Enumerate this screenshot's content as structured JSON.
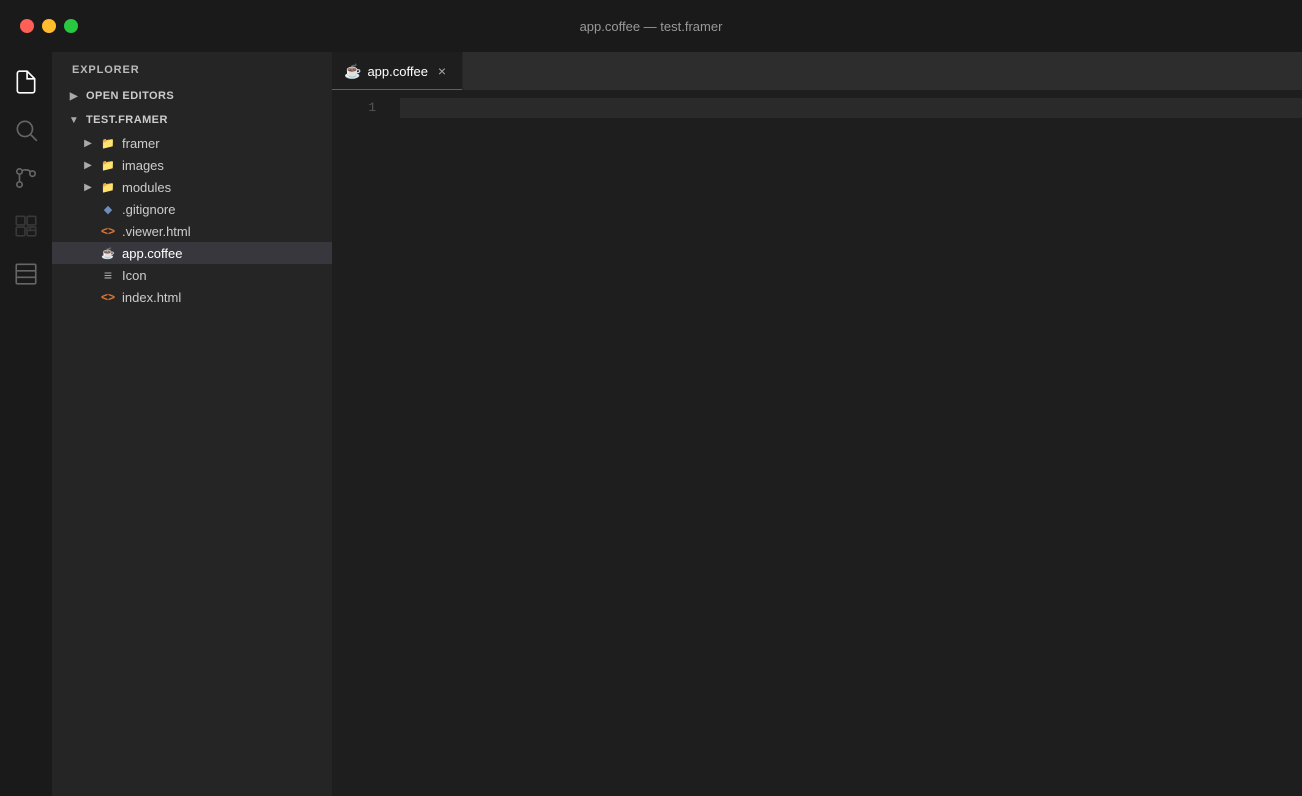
{
  "titlebar": {
    "title": "app.coffee — test.framer",
    "controls": {
      "close_label": "",
      "min_label": "",
      "max_label": ""
    }
  },
  "activity_bar": {
    "icons": [
      {
        "name": "explorer-icon",
        "label": "Explorer",
        "active": true
      },
      {
        "name": "search-icon",
        "label": "Search",
        "active": false
      },
      {
        "name": "source-control-icon",
        "label": "Source Control",
        "active": false
      },
      {
        "name": "extensions-icon",
        "label": "Extensions",
        "active": false
      },
      {
        "name": "layout-icon",
        "label": "Layout",
        "active": false
      }
    ]
  },
  "sidebar": {
    "header": "EXPLORER",
    "sections": [
      {
        "name": "open-editors",
        "label": "OPEN EDITORS",
        "collapsed": true
      },
      {
        "name": "test-framer",
        "label": "TEST.FRAMER",
        "expanded": true,
        "items": [
          {
            "name": "framer",
            "type": "folder",
            "label": "framer",
            "indent": 0
          },
          {
            "name": "images",
            "type": "folder",
            "label": "images",
            "indent": 0
          },
          {
            "name": "modules",
            "type": "folder",
            "label": "modules",
            "indent": 0
          },
          {
            "name": ".gitignore",
            "type": "gitignore",
            "label": ".gitignore",
            "indent": 0
          },
          {
            "name": ".viewer.html",
            "type": "html",
            "label": ".viewer.html",
            "indent": 0
          },
          {
            "name": "app.coffee",
            "type": "coffee",
            "label": "app.coffee",
            "indent": 0,
            "selected": true
          },
          {
            "name": "Icon",
            "type": "text",
            "label": "Icon",
            "indent": 0
          },
          {
            "name": "index.html",
            "type": "html",
            "label": "index.html",
            "indent": 0
          }
        ]
      }
    ]
  },
  "editor": {
    "tab_label": "app.coffee",
    "tab_close_label": "×",
    "line_numbers": [
      "1"
    ],
    "cursor_line": 1
  },
  "colors": {
    "accent": "#007acc",
    "coffee_icon": "#d4a017",
    "html_icon": "#e37933",
    "git_icon": "#6c8ebf",
    "text_icon": "#aaa"
  }
}
